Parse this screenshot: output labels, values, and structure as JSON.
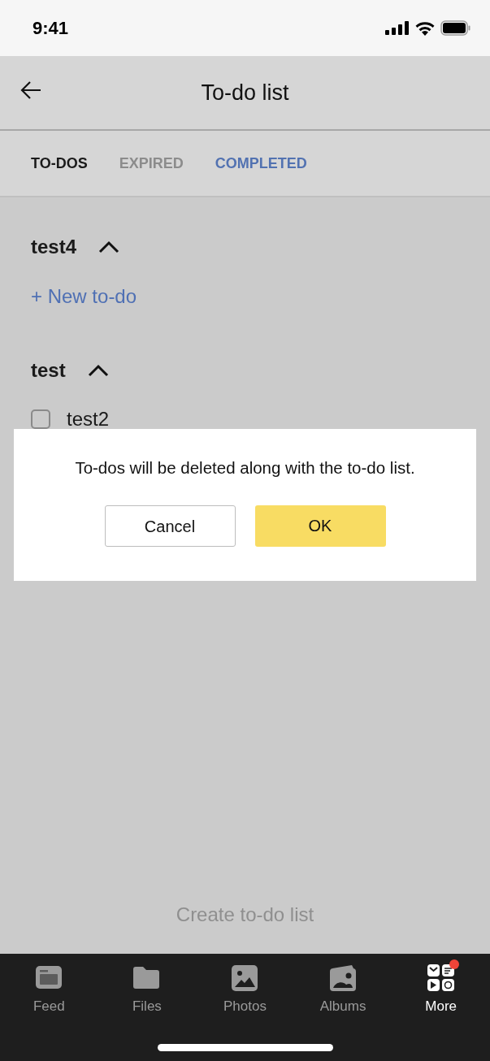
{
  "status_bar": {
    "time": "9:41"
  },
  "header": {
    "title": "To-do list"
  },
  "tabs": [
    {
      "label": "TO-DOS",
      "selected": false,
      "disabled": false
    },
    {
      "label": "EXPIRED",
      "selected": false,
      "disabled": true
    },
    {
      "label": "COMPLETED",
      "selected": true,
      "disabled": false
    }
  ],
  "lists": [
    {
      "name": "test4",
      "expanded": true,
      "add_label": "+ New to-do"
    },
    {
      "name": "test",
      "expanded": true,
      "items": [
        {
          "text": "test2",
          "checked": false
        }
      ]
    }
  ],
  "dialog": {
    "message": "To-dos will be deleted along with the to-do list.",
    "buttons": [
      {
        "label": "Cancel",
        "kind": "secondary"
      },
      {
        "label": "OK",
        "kind": "primary"
      }
    ]
  },
  "create_button": "Create to-do list",
  "nav": [
    {
      "label": "Feed",
      "selected": false,
      "badge": false
    },
    {
      "label": "Files",
      "selected": false,
      "badge": false
    },
    {
      "label": "Photos",
      "selected": false,
      "badge": false
    },
    {
      "label": "Albums",
      "selected": false,
      "badge": false
    },
    {
      "label": "More",
      "selected": true,
      "badge": true
    }
  ]
}
